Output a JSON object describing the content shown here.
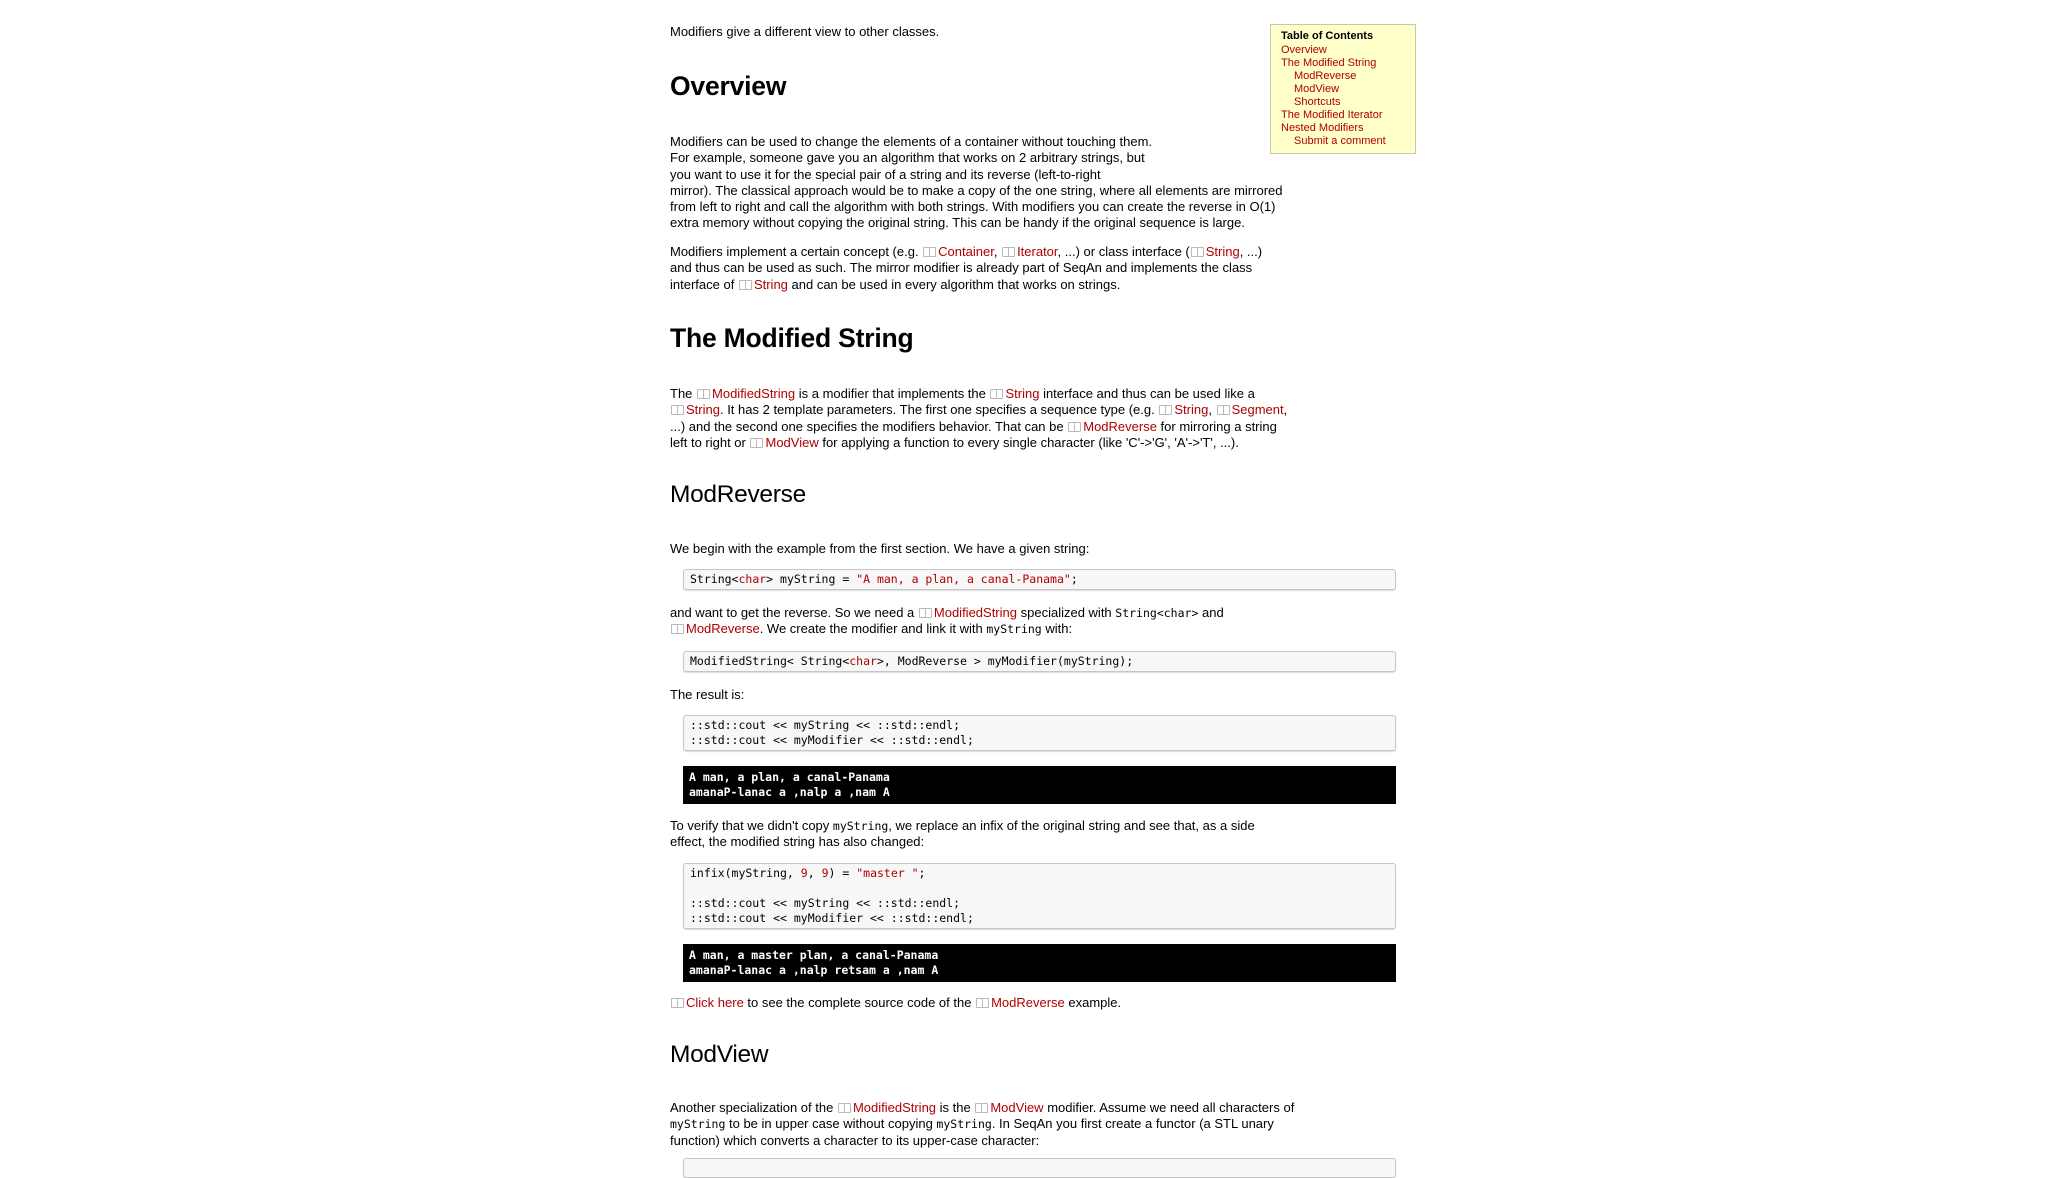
{
  "intro": "Modifiers give a different view to other classes.",
  "toc": {
    "title": "Table of Contents",
    "items": [
      "Overview",
      "The Modified String",
      "ModReverse",
      "ModView",
      "Shortcuts",
      "The Modified Iterator",
      "Nested Modifiers",
      "Submit a comment"
    ]
  },
  "overview": {
    "heading": "Overview",
    "p1_l1": "Modifiers can be used to change the elements of a container without touching them.",
    "p1_l2": "For example, someone gave you an algorithm that works on 2 arbitrary strings, but",
    "p1_l3": "you want to use it for the special pair of a string and its reverse (left-to-right",
    "p1_l4": "mirror). The classical approach would be to make a copy of the one string, where all elements are mirrored",
    "p1_l5": "from left to right and call the algorithm with both strings. With modifiers you can create the reverse in O(1)",
    "p1_l6": "extra memory without copying the original string. This can be handy if the original sequence is large.",
    "p2_a": "Modifiers implement a certain concept (e.g. ",
    "p2_b": ", ",
    "p2_c": ", ...) or class interface (",
    "p2_d": ", ...)",
    "p2_l2": "and thus can be used as such. The mirror modifier is already part of SeqAn and implements the class",
    "p2_l3a": "interface of ",
    "p2_l3b": " and can be used in every algorithm that works on strings."
  },
  "refs": {
    "container": "Container",
    "iterator": "Iterator",
    "string": "String",
    "modifiedstring": "ModifiedString",
    "segment": "Segment",
    "modreverse": "ModReverse",
    "modview": "ModView",
    "clickhere": "Click here"
  },
  "modstring": {
    "heading": "The Modified String",
    "l1a": "The ",
    "l1b": " is a modifier that implements the ",
    "l1c": " interface and thus can be used like a",
    "l2a": ". It has 2 template parameters. The first one specifies a sequence type (e.g. ",
    "l2b": ", ",
    "l2c": ",",
    "l3a": "...) and the second one specifies the modifiers behavior. That can be ",
    "l3b": " for mirroring a string",
    "l4a": "left to right or ",
    "l4b": " for applying a function to every single character (like 'C'->'G', 'A'->'T', ...)."
  },
  "modreverse": {
    "heading": "ModReverse",
    "p1": "We begin with the example from the first section. We have a given string:",
    "code1_a": "String<",
    "code1_kw": "char",
    "code1_b": "> myString = ",
    "code1_str": "\"A man, a plan, a canal-Panama\"",
    "code1_c": ";",
    "p2a": "and want to get the reverse. So we need a ",
    "p2b": " specialized with ",
    "p2c": "String<char>",
    "p2d": " and",
    "p2e": ". We create the modifier and link it with ",
    "p2f": "myString",
    "p2g": " with:",
    "code2_a": "ModifiedString< String<",
    "code2_kw": "char",
    "code2_b": ">, ModReverse > myModifier(myString);",
    "p3": "The result is:",
    "code3_l1": "::std::cout << myString << ::std::endl;",
    "code3_l2": "::std::cout << myModifier << ::std::endl;",
    "out1_l1": "A man, a plan, a canal-Panama",
    "out1_l2": "amanaP-lanac a ,nalp a ,nam A",
    "p4a": "To verify that we didn't copy ",
    "p4b": "myString",
    "p4c": ", we replace an infix of the original string and see that, as a side",
    "p4l2": "effect, the modified string has also changed:",
    "code4_a": "infix(myString, ",
    "code4_n1": "9",
    "code4_b": ", ",
    "code4_n2": "9",
    "code4_c": ") = ",
    "code4_str": "\"master \"",
    "code4_d": ";",
    "code4_l3": "::std::cout << myString << ::std::endl;",
    "code4_l4": "::std::cout << myModifier << ::std::endl;",
    "out2_l1": "A man, a master plan, a canal-Panama",
    "out2_l2": "amanaP-lanac a ,nalp retsam a ,nam A",
    "p5a": " to see the complete source code of the ",
    "p5b": " example."
  },
  "modview": {
    "heading": "ModView",
    "l1a": "Another specialization of the ",
    "l1b": " is the ",
    "l1c": " modifier. Assume we need all characters of",
    "l2a": "myString",
    "l2b": " to be in upper case without copying ",
    "l2c": "myString",
    "l2d": ". In SeqAn you first create a functor (a STL unary",
    "l3": "function) which converts a character to its upper-case character:"
  }
}
